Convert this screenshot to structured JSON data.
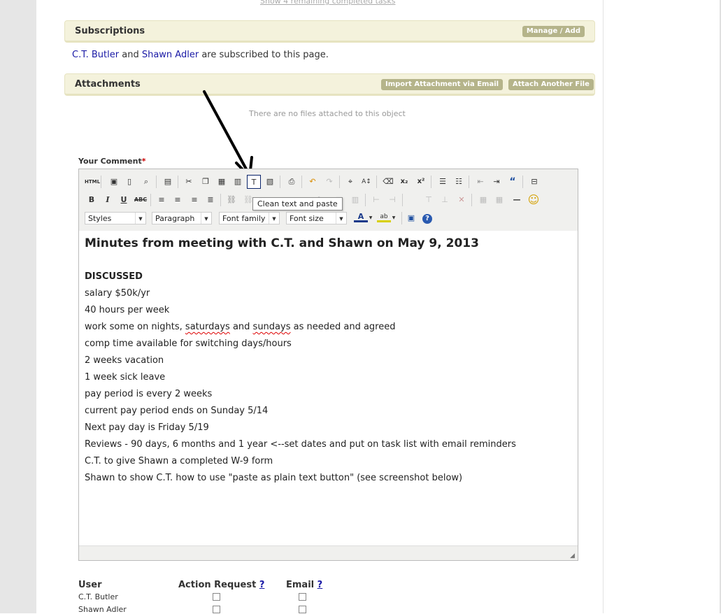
{
  "show_remaining_link": "Show 4 remaining completed tasks",
  "subscriptions": {
    "title": "Subscriptions",
    "manage_button": "Manage / Add",
    "subscriber_1": "C.T. Butler",
    "connector": "and",
    "subscriber_2": "Shawn Adler",
    "suffix": "are subscribed to this page."
  },
  "attachments": {
    "title": "Attachments",
    "import_button": "Import Attachment via Email",
    "attach_button": "Attach Another File",
    "empty_text": "There are no files attached to this object"
  },
  "comment": {
    "label": "Your Comment",
    "required_mark": "*"
  },
  "toolbar": {
    "html_label": "HTML",
    "bold": "B",
    "italic": "I",
    "underline": "U",
    "strike": "ABC",
    "styles": "Styles",
    "format": "Paragraph",
    "font_family": "Font family",
    "font_size": "Font size",
    "tooltip": "Clean text and paste",
    "accent_color": "#0a246a"
  },
  "editor_content": {
    "heading": "Minutes from meeting with C.T. and Shawn on May 9, 2013",
    "discussed": "DISCUSSED",
    "line_salary": "salary $50k/yr",
    "line_hours": "40 hours per week",
    "line_nights_a": "work some on nights, ",
    "line_nights_b": "saturdays",
    "line_nights_c": " and ",
    "line_nights_d": "sundays",
    "line_nights_e": " as needed and agreed",
    "line_comp": "comp time available for switching days/hours",
    "line_vacation": "2 weeks vacation",
    "line_sick": "1 week sick leave",
    "line_pay_period": "pay period is every 2 weeks",
    "line_current": "current pay period ends on Sunday 5/14",
    "line_payday": "Next pay day is Friday 5/19",
    "line_reviews": "Reviews - 90 days, 6 months and 1 year <--set dates and put on task list with email reminders",
    "line_w9": "C.T. to give Shawn a completed W-9 form",
    "line_paste": "Shawn to show C.T. how to use \"paste as plain text button\" (see screenshot below)"
  },
  "notify_table": {
    "col_user": "User",
    "col_action": "Action Request",
    "col_email": "Email",
    "help_mark": "?",
    "users": [
      "C.T. Butler",
      "Shawn Adler"
    ]
  }
}
